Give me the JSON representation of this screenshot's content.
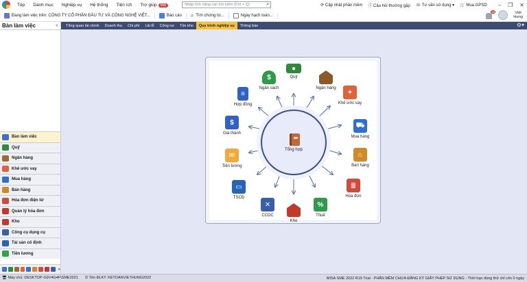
{
  "menubar": {
    "items": [
      "Tệp",
      "Danh mục",
      "Nghiệp vụ",
      "Hệ thống",
      "Tiện ích",
      "Trợ giúp"
    ],
    "new_badge": "Mới",
    "search_placeholder": "Nhập tính năng cần tìm kiếm (Ctrl + Q)",
    "right_items": [
      "Cập nhật phần mềm",
      "Câu hỏi thường gặp",
      "Tư vấn sử dụng",
      "Mua GPSD"
    ]
  },
  "toolbar": {
    "workspace": "Đang làm việc trên: CÔNG TY CỔ PHẦN ĐẦU TƯ VÀ CÔNG NGHỆ VIỆT...",
    "report": "Báo cáo",
    "find_voucher": "Tìm chứng từ...",
    "posting_date": "Ngày hạch toán...",
    "notif_count": "15",
    "user_name_line1": "Việt",
    "user_name_line2": "Hưng"
  },
  "left_panel": {
    "title": "Bàn làm việc",
    "collapse": "«",
    "nav": [
      {
        "label": "Bàn làm việc",
        "color": "#3d6fd8",
        "active": true
      },
      {
        "label": "Quỹ",
        "color": "#2e8b3a"
      },
      {
        "label": "Ngân hàng",
        "color": "#9b6b2f"
      },
      {
        "label": "Khế ước vay",
        "color": "#e0623b"
      },
      {
        "label": "Mua hàng",
        "color": "#2f6fcf"
      },
      {
        "label": "Bán hàng",
        "color": "#d08a2a"
      },
      {
        "label": "Hóa đơn điện tử",
        "color": "#d24a3a"
      },
      {
        "label": "Quản lý hóa đơn",
        "color": "#c0392b"
      },
      {
        "label": "Kho",
        "color": "#c0392b"
      },
      {
        "label": "Công cụ dụng cụ",
        "color": "#3a5fa8"
      },
      {
        "label": "Tài sản cố định",
        "color": "#2566b8"
      },
      {
        "label": "Tiền lương",
        "color": "#3aa14a"
      }
    ]
  },
  "tabs": [
    {
      "label": "Tổng quan tài chính"
    },
    {
      "label": "Doanh thu"
    },
    {
      "label": "Chi phí"
    },
    {
      "label": "Lãi lỗ"
    },
    {
      "label": "Công nợ"
    },
    {
      "label": "Tồn kho"
    },
    {
      "label": "Quy trình nghiệp vụ",
      "active": true
    },
    {
      "label": "Thông báo"
    }
  ],
  "diagram": {
    "hub": "Tổng hợp",
    "modules": {
      "ngan_sach": "Ngân sách",
      "quy": "Quỹ",
      "ngan_hang": "Ngân hàng",
      "khe_uoc_vay": "Khế ước vay",
      "hop_dong": "Hợp đồng",
      "mua_hang": "Mua hàng",
      "gia_thanh": "Giá thành",
      "ban_hang": "Bán hàng",
      "tien_luong": "Tiền lương",
      "hoa_don": "Hóa đơn",
      "tscd": "TSCĐ",
      "ccdc": "CCDC",
      "kho": "Kho",
      "thue": "Thuế"
    }
  },
  "statusbar": {
    "server": "Máy chủ: DESKTOP-G9V4G4F\\SME2021",
    "login": "Tên ĐLKT: KETOANVIETHUNG2022",
    "right": "MISA SME 2022 R19 Trial - PHẦN MỀM CHƯA ĐĂNG KÝ GIẤY PHÉP SỬ DỤNG - Thời hạn dùng thử chỉ còn 0 ngày"
  }
}
